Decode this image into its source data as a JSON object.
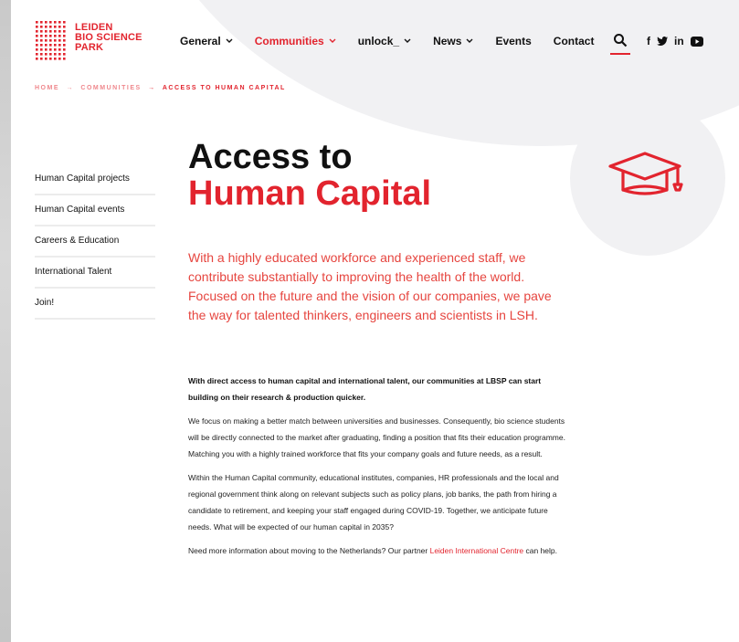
{
  "brand": {
    "logo_text": [
      "LEIDEN",
      "BIO SCIENCE",
      "PARK"
    ],
    "accent_color": "#e2242e"
  },
  "nav": {
    "items": [
      {
        "label": "General",
        "dropdown": true,
        "active": false
      },
      {
        "label": "Communities",
        "dropdown": true,
        "active": true
      },
      {
        "label": "unlock_",
        "dropdown": true,
        "active": false
      },
      {
        "label": "News",
        "dropdown": true,
        "active": false
      },
      {
        "label": "Events",
        "dropdown": false,
        "active": false
      },
      {
        "label": "Contact",
        "dropdown": false,
        "active": false
      }
    ],
    "search_icon": "search-icon",
    "social": [
      "f",
      "🐦",
      "in",
      "▶"
    ]
  },
  "breadcrumb": {
    "home": "HOME",
    "communities": "COMMUNITIES",
    "current": "ACCESS TO HUMAN CAPITAL",
    "separator": "→"
  },
  "sidebar": {
    "items": [
      {
        "label": "Human Capital projects"
      },
      {
        "label": "Human Capital events"
      },
      {
        "label": "Careers & Education"
      },
      {
        "label": "International Talent"
      },
      {
        "label": "Join!"
      }
    ]
  },
  "main": {
    "title_line1": "Access to",
    "title_line2": "Human Capital",
    "intro": "With a highly educated workforce and experienced staff, we contribute substantially to improving the health of the world. Focused on the future and the vision of our companies, we pave the way for talented thinkers, engineers and scientists in LSH.",
    "lead": "With direct access to human capital and international talent, our communities at LBSP can start building on their research & production quicker.",
    "para1": "We focus on making a better match between universities and businesses. Consequently, bio science students will be directly connected to the market after graduating, finding a position that fits their education programme. Matching you with a highly trained workforce that fits your company goals and future needs, as a result.",
    "para2": "Within the Human Capital community, educational institutes, companies, HR professionals and the local and regional government think along on relevant subjects such as policy plans, job banks, the path from hiring a candidate to retirement, and keeping your staff engaged during COVID-19. Together, we anticipate future needs. What will be expected of our human capital in 2035?",
    "para3_prefix": "Need more information about moving to the Netherlands? Our partner ",
    "para3_link": "Leiden International Centre",
    "para3_suffix": " can help."
  },
  "icon": {
    "name": "graduation-cap-icon"
  }
}
